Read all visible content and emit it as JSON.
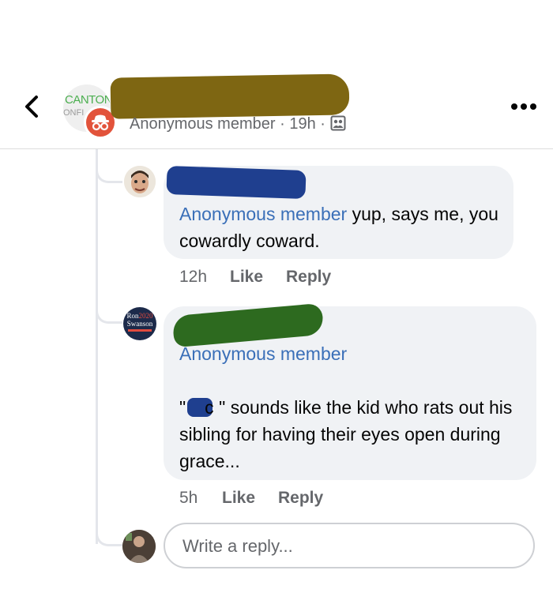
{
  "header": {
    "group_logo_line1": "CANTON",
    "group_logo_line2": "ONFI",
    "author": "Anonymous member",
    "time": "19h",
    "separator": "·",
    "back_icon": "chevron-left-icon",
    "more_icon": "more-horizontal-icon",
    "audience_icon": "group-audience-icon"
  },
  "comments": [
    {
      "mention": "Anonymous member",
      "text": " yup, says me, you cowardly coward.",
      "time": "12h",
      "like": "Like",
      "reply": "Reply"
    },
    {
      "avatar_line1": "Ron",
      "avatar_line2": "2020",
      "avatar_line3": "Swanson",
      "mention": "Anonymous member",
      "text": "\"",
      "redacted_word_visible": "c",
      "text_rest": "\" sounds like the kid who rats out his sibling for having their eyes open during grace...",
      "time": "5h",
      "like": "Like",
      "reply": "Reply"
    }
  ],
  "reply_box": {
    "placeholder": "Write a reply..."
  },
  "colors": {
    "link": "#3a6fb8",
    "secondary_text": "#65676b",
    "bubble": "#f0f2f5",
    "anon_badge": "#e2533b"
  }
}
